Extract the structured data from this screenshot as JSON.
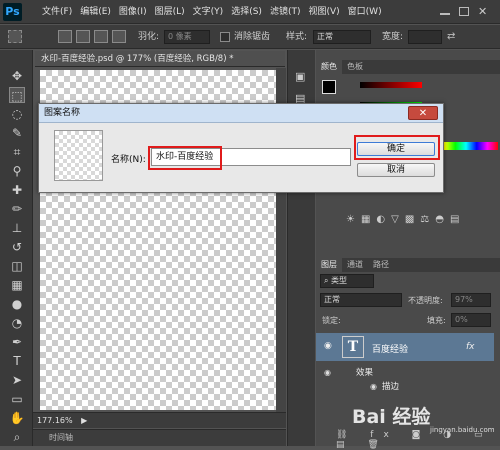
{
  "app": {
    "logo": "Ps",
    "menus": [
      "文件(F)",
      "编辑(E)",
      "图像(I)",
      "图层(L)",
      "文字(Y)",
      "选择(S)",
      "滤镜(T)",
      "视图(V)",
      "窗口(W)"
    ]
  },
  "options": {
    "feather_label": "羽化:",
    "feather_value": "0 像素",
    "antialias_label": "消除锯齿",
    "style_label": "样式:",
    "style_value": "正常",
    "width_label": "宽度:"
  },
  "document": {
    "tab": "水印-百度经验.psd @ 177% (百度经验, RGB/8) *",
    "zoom": "177.16%",
    "timeline": "时间轴"
  },
  "panels": {
    "color_tabs": [
      "颜色",
      "色板"
    ],
    "layers_tabs": [
      "图层",
      "通道",
      "路径"
    ],
    "kind_label": "类型",
    "blend_mode": "正常",
    "opacity_label": "不透明度:",
    "opacity_value": "97%",
    "lock_label": "锁定:",
    "fill_label": "填充:",
    "fill_value": "0%",
    "layer_name": "百度经验",
    "effects_label": "效果",
    "stroke_label": "描边",
    "fx": "fx"
  },
  "dialog": {
    "title": "图案名称",
    "name_label": "名称(N):",
    "name_value": "水印-百度经验",
    "ok_label": "确定",
    "cancel_label": "取消",
    "close_glyph": "✕"
  },
  "watermark": {
    "text": "Bai 经验",
    "url": "jingyan.baidu.com"
  },
  "colors": {
    "highlight": "#e01b1b",
    "brand": "#31a8ff"
  }
}
